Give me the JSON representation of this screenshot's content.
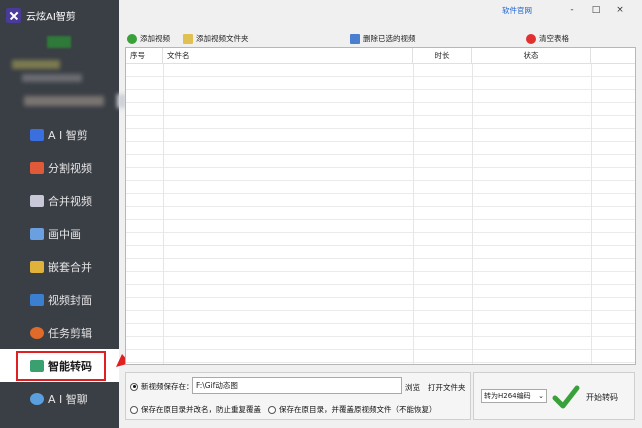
{
  "app": {
    "title": "云炫AI智剪"
  },
  "window": {
    "link": "软件官网",
    "minimize": "-",
    "maximize": "□",
    "close": "×"
  },
  "sidebar": {
    "items": [
      {
        "label": "A I 智剪",
        "icon": "ai-cut-icon",
        "color": "#3a6fe0"
      },
      {
        "label": "分割视频",
        "icon": "split-icon",
        "color": "#e05a3a"
      },
      {
        "label": "合并视频",
        "icon": "merge-icon",
        "color": "#c7c7d8"
      },
      {
        "label": "画中画",
        "icon": "pip-icon",
        "color": "#6aa0e0"
      },
      {
        "label": "嵌套合并",
        "icon": "nest-icon",
        "color": "#e0b23a"
      },
      {
        "label": "视频封面",
        "icon": "cover-icon",
        "color": "#3a7fd0"
      },
      {
        "label": "任务剪辑",
        "icon": "task-icon",
        "color": "#e06a2a"
      },
      {
        "label": "智能转码",
        "icon": "transcode-icon",
        "color": "#3aa070",
        "active": true
      },
      {
        "label": "A I 智聊",
        "icon": "chat-icon",
        "color": "#5aa0e0"
      }
    ]
  },
  "toolbar": {
    "add_video": "添加视频",
    "add_folder": "添加视频文件夹",
    "delete_selected": "删除已选的视频",
    "clear_table": "清空表格"
  },
  "table": {
    "columns": [
      "序号",
      "文件名",
      "时长",
      "状态"
    ]
  },
  "output": {
    "new_location_label": "新视频保存在：",
    "path_value": "F:\\Gif动态图",
    "browse": "浏览",
    "open_folder": "打开文件夹",
    "option_rename": "保存在原目录并改名，防止重复覆盖",
    "option_overwrite": "保存在原目录，并覆盖原视频文件（不能恢复）"
  },
  "convert": {
    "format_selected": "转为H264编码",
    "start_label": "开始转码"
  }
}
